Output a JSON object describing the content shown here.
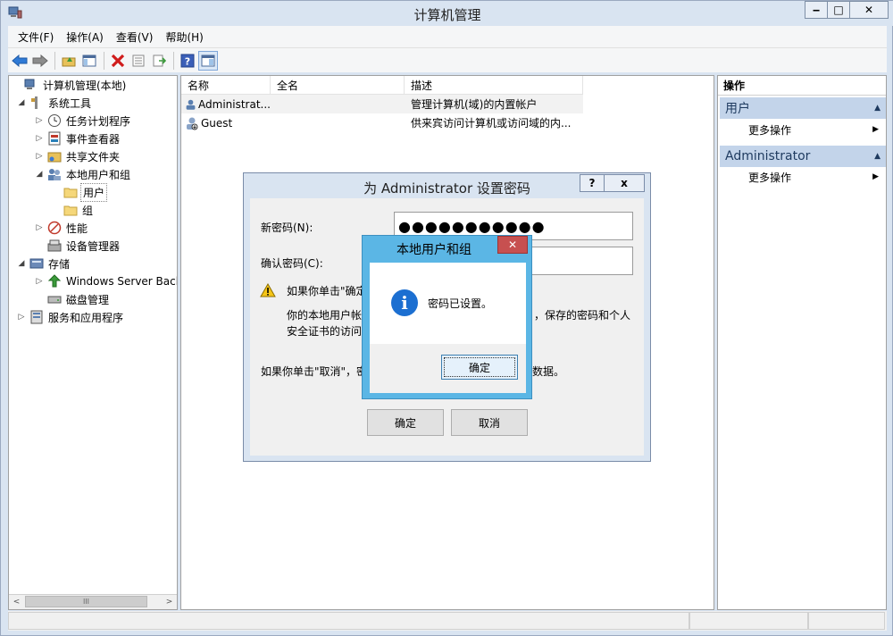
{
  "window": {
    "title": "计算机管理",
    "minimize": "‒",
    "maximize": "□",
    "close": "✕"
  },
  "menu": [
    "文件(F)",
    "操作(A)",
    "查看(V)",
    "帮助(H)"
  ],
  "tree": {
    "items": [
      {
        "label": "计算机管理(本地)",
        "expander": ""
      },
      {
        "label": "系统工具",
        "expander": "◢"
      },
      {
        "label": "任务计划程序",
        "expander": "▷"
      },
      {
        "label": "事件查看器",
        "expander": "▷"
      },
      {
        "label": "共享文件夹",
        "expander": "▷"
      },
      {
        "label": "本地用户和组",
        "expander": "◢"
      },
      {
        "label": "用户",
        "expander": ""
      },
      {
        "label": "组",
        "expander": ""
      },
      {
        "label": "性能",
        "expander": "▷"
      },
      {
        "label": "设备管理器",
        "expander": ""
      },
      {
        "label": "存储",
        "expander": "◢"
      },
      {
        "label": "Windows Server Back",
        "expander": "▷"
      },
      {
        "label": "磁盘管理",
        "expander": ""
      },
      {
        "label": "服务和应用程序",
        "expander": "▷"
      }
    ],
    "scroll_left": "<",
    "scroll_right": ">",
    "scroll_grip": "III"
  },
  "list": {
    "columns": [
      "名称",
      "全名",
      "描述"
    ],
    "rows": [
      {
        "name": "Administrat...",
        "fullname": "",
        "desc": "管理计算机(域)的内置帐户"
      },
      {
        "name": "Guest",
        "fullname": "",
        "desc": "供来宾访问计算机或访问域的内..."
      }
    ]
  },
  "actions": {
    "title": "操作",
    "groups": [
      {
        "name": "用户",
        "item": "更多操作"
      },
      {
        "name": "Administrator",
        "item": "更多操作"
      }
    ],
    "caret": "▲",
    "item_arrow": "▶"
  },
  "password_dialog": {
    "title": "为 Administrator 设置密码",
    "help": "?",
    "close": "x",
    "new_label": "新密码(N):",
    "new_value": "●●●●●●●●●●●",
    "confirm_label": "确认密码(C):",
    "confirm_value": "",
    "warn_line1": "如果你单击\"确定",
    "warn_line1_right": "",
    "info_line1": "你的本地用户帐",
    "info_line1_right": "，保存的密码和个人",
    "info_line2": "安全证书的访问",
    "cancel_line": "如果你单击\"取消\"，密",
    "cancel_line_right": "数据。",
    "ok": "确定",
    "cancel": "取消"
  },
  "message_box": {
    "title": "本地用户和组",
    "close": "✕",
    "text": "密码已设置。",
    "icon": "i",
    "ok": "确定"
  }
}
